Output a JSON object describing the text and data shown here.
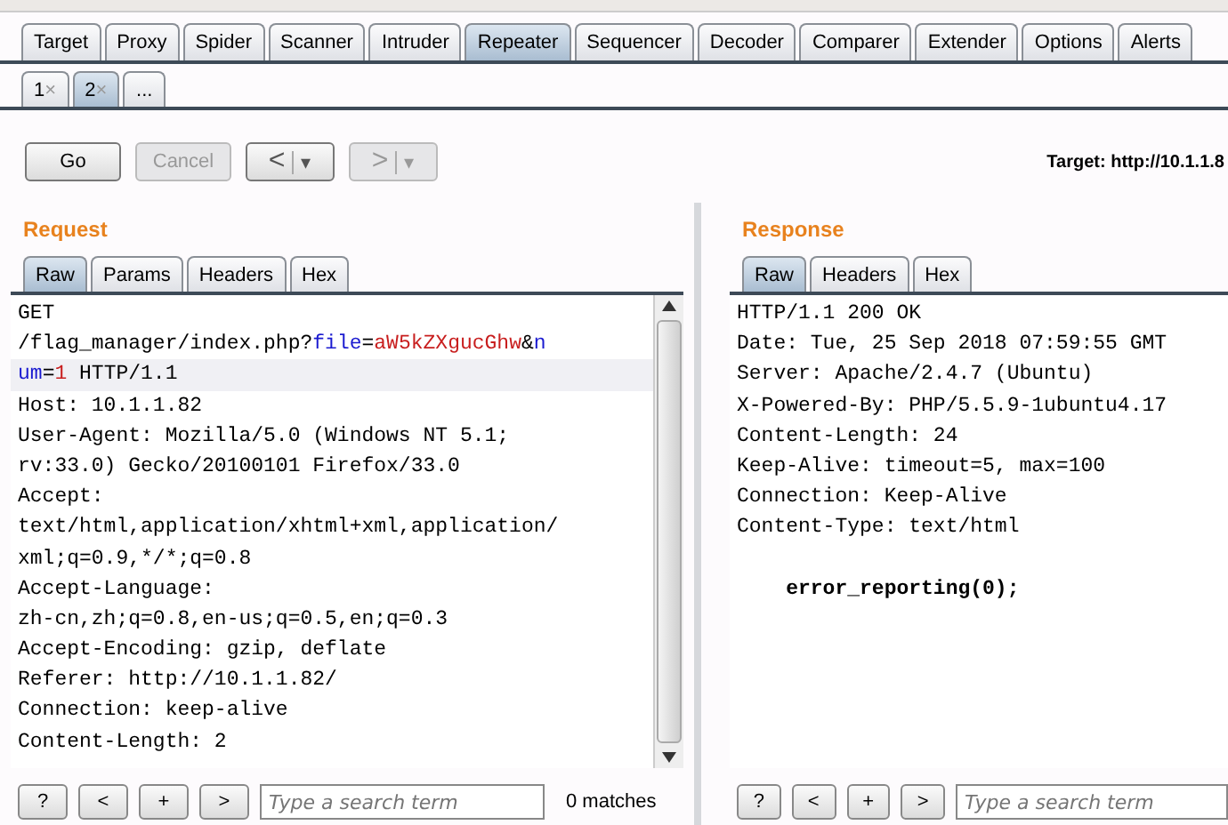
{
  "main_tabs": [
    {
      "label": "Target",
      "selected": false
    },
    {
      "label": "Proxy",
      "selected": false
    },
    {
      "label": "Spider",
      "selected": false
    },
    {
      "label": "Scanner",
      "selected": false
    },
    {
      "label": "Intruder",
      "selected": false
    },
    {
      "label": "Repeater",
      "selected": true
    },
    {
      "label": "Sequencer",
      "selected": false
    },
    {
      "label": "Decoder",
      "selected": false
    },
    {
      "label": "Comparer",
      "selected": false
    },
    {
      "label": "Extender",
      "selected": false
    },
    {
      "label": "Options",
      "selected": false
    },
    {
      "label": "Alerts",
      "selected": false
    }
  ],
  "request_tabs": [
    {
      "label": "1",
      "close": "×",
      "selected": false
    },
    {
      "label": "2",
      "close": "×",
      "selected": true
    },
    {
      "label": "...",
      "selected": false
    }
  ],
  "toolbar": {
    "go": {
      "label": "Go",
      "disabled": false
    },
    "cancel": {
      "label": "Cancel",
      "disabled": true
    },
    "back": {
      "label": "<",
      "caret": "▾",
      "disabled": false
    },
    "forward": {
      "label": ">",
      "caret": "▾",
      "disabled": true
    },
    "target": "Target: http://10.1.1.8"
  },
  "request": {
    "title": "Request",
    "tabs": [
      {
        "label": "Raw",
        "selected": true
      },
      {
        "label": "Params",
        "selected": false
      },
      {
        "label": "Headers",
        "selected": false
      },
      {
        "label": "Hex",
        "selected": false
      }
    ],
    "lines": [
      {
        "current": false,
        "segments": [
          {
            "kind": "plain",
            "text": "GET"
          }
        ]
      },
      {
        "current": false,
        "segments": [
          {
            "kind": "plain",
            "text": "/flag_manager/index.php?"
          },
          {
            "kind": "name",
            "text": "file"
          },
          {
            "kind": "plain",
            "text": "="
          },
          {
            "kind": "value",
            "text": "aW5kZXgucGhw"
          },
          {
            "kind": "plain",
            "text": "&"
          },
          {
            "kind": "name",
            "text": "n"
          }
        ]
      },
      {
        "current": true,
        "segments": [
          {
            "kind": "name",
            "text": "um"
          },
          {
            "kind": "plain",
            "text": "="
          },
          {
            "kind": "value",
            "text": "1"
          },
          {
            "kind": "plain",
            "text": " HTTP/1.1"
          }
        ]
      },
      {
        "current": false,
        "segments": [
          {
            "kind": "plain",
            "text": "Host: 10.1.1.82"
          }
        ]
      },
      {
        "current": false,
        "segments": [
          {
            "kind": "plain",
            "text": "User-Agent: Mozilla/5.0 (Windows NT 5.1;"
          }
        ]
      },
      {
        "current": false,
        "segments": [
          {
            "kind": "plain",
            "text": "rv:33.0) Gecko/20100101 Firefox/33.0"
          }
        ]
      },
      {
        "current": false,
        "segments": [
          {
            "kind": "plain",
            "text": "Accept:"
          }
        ]
      },
      {
        "current": false,
        "segments": [
          {
            "kind": "plain",
            "text": "text/html,application/xhtml+xml,application/"
          }
        ]
      },
      {
        "current": false,
        "segments": [
          {
            "kind": "plain",
            "text": "xml;q=0.9,*/*;q=0.8"
          }
        ]
      },
      {
        "current": false,
        "segments": [
          {
            "kind": "plain",
            "text": "Accept-Language:"
          }
        ]
      },
      {
        "current": false,
        "segments": [
          {
            "kind": "plain",
            "text": "zh-cn,zh;q=0.8,en-us;q=0.5,en;q=0.3"
          }
        ]
      },
      {
        "current": false,
        "segments": [
          {
            "kind": "plain",
            "text": "Accept-Encoding: gzip, deflate"
          }
        ]
      },
      {
        "current": false,
        "segments": [
          {
            "kind": "plain",
            "text": "Referer: http://10.1.1.82/"
          }
        ]
      },
      {
        "current": false,
        "segments": [
          {
            "kind": "plain",
            "text": "Connection: keep-alive"
          }
        ]
      },
      {
        "current": false,
        "segments": [
          {
            "kind": "plain",
            "text": "Content-Length: 2"
          }
        ]
      }
    ],
    "search": {
      "help": "?",
      "prev": "<",
      "add": "+",
      "next": ">",
      "placeholder": "Type a search term",
      "matches": "0 matches"
    }
  },
  "response": {
    "title": "Response",
    "tabs": [
      {
        "label": "Raw",
        "selected": true
      },
      {
        "label": "Headers",
        "selected": false
      },
      {
        "label": "Hex",
        "selected": false
      }
    ],
    "lines": [
      {
        "bold": false,
        "text": "HTTP/1.1 200 OK"
      },
      {
        "bold": false,
        "text": "Date: Tue, 25 Sep 2018 07:59:55 GMT"
      },
      {
        "bold": false,
        "text": "Server: Apache/2.4.7 (Ubuntu)"
      },
      {
        "bold": false,
        "text": "X-Powered-By: PHP/5.5.9-1ubuntu4.17"
      },
      {
        "bold": false,
        "text": "Content-Length: 24"
      },
      {
        "bold": false,
        "text": "Keep-Alive: timeout=5, max=100"
      },
      {
        "bold": false,
        "text": "Connection: Keep-Alive"
      },
      {
        "bold": false,
        "text": "Content-Type: text/html"
      },
      {
        "bold": true,
        "blank_before": true,
        "text": "    error_reporting(0);"
      }
    ],
    "search": {
      "help": "?",
      "prev": "<",
      "add": "+",
      "next": ">",
      "placeholder": "Type a search term"
    }
  }
}
